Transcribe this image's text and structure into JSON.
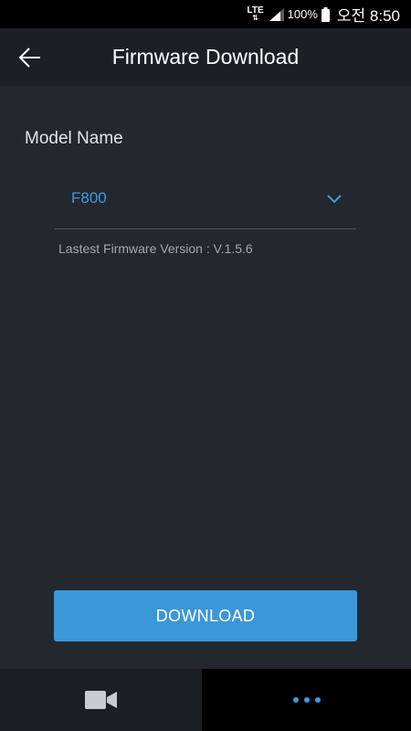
{
  "status_bar": {
    "network": "LTE",
    "battery": "100%",
    "time": "오전 8:50"
  },
  "app_bar": {
    "title": "Firmware Download",
    "back_icon": "arrow-left-icon"
  },
  "model": {
    "label": "Model Name",
    "selected": "F800",
    "dropdown_icon": "chevron-down-icon"
  },
  "firmware": {
    "latest_version_text": "Lastest Firmware Version : V.1.5.6"
  },
  "actions": {
    "download_label": "DOWNLOAD"
  },
  "bottom_nav": {
    "items": [
      {
        "icon": "video-camera-icon",
        "active": false
      },
      {
        "icon": "more-icon",
        "active": true
      }
    ]
  },
  "colors": {
    "background": "#23272e",
    "app_bar": "#1c1f24",
    "accent": "#3d9be0",
    "button": "#3b97d8"
  }
}
